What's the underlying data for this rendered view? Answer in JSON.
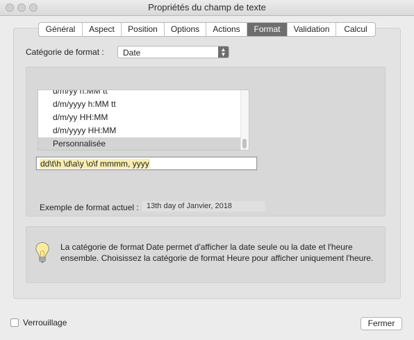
{
  "window": {
    "title": "Propriétés du champ de texte"
  },
  "tabs": [
    {
      "label": "Général"
    },
    {
      "label": "Aspect"
    },
    {
      "label": "Position"
    },
    {
      "label": "Options"
    },
    {
      "label": "Actions"
    },
    {
      "label": "Format"
    },
    {
      "label": "Validation"
    },
    {
      "label": "Calcul"
    }
  ],
  "active_tab": "Format",
  "format_category": {
    "label": "Catégorie de format :",
    "value": "Date"
  },
  "format_list": {
    "items": [
      {
        "label": "d/m/yy h:MM tt"
      },
      {
        "label": "d/m/yyyy h:MM tt"
      },
      {
        "label": "d/m/yy HH:MM"
      },
      {
        "label": "d/m/yyyy HH:MM"
      },
      {
        "label": "Personnalisée"
      }
    ],
    "selected": "Personnalisée"
  },
  "custom_format": {
    "value": "dd\\t\\h \\d\\a\\y \\o\\f mmmm, yyyy"
  },
  "example": {
    "label": "Exemple de format actuel :",
    "value": "13th day of Janvier, 2018"
  },
  "info": {
    "text": "La catégorie de format Date permet d'afficher la date seule ou la date et l'heure ensemble. Choisissez la catégorie de format Heure pour afficher uniquement l'heure."
  },
  "footer": {
    "lock_label": "Verrouillage",
    "lock_checked": false,
    "close_label": "Fermer"
  }
}
